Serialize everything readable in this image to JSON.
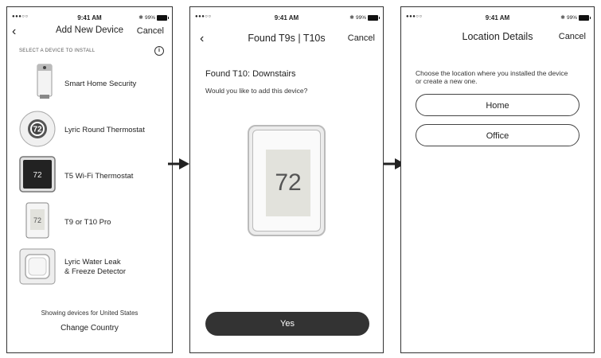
{
  "status": {
    "signal": "●●●○○",
    "time": "9:41 AM",
    "battery": "99%"
  },
  "screen1": {
    "title": "Add New Device",
    "cancel": "Cancel",
    "section": "SELECT A DEVICE TO INSTALL",
    "devices": [
      {
        "label": "Smart Home Security"
      },
      {
        "label": "Lyric Round Thermostat",
        "display": "72"
      },
      {
        "label": "T5 Wi-Fi Thermostat",
        "display": "72"
      },
      {
        "label": "T9 or T10 Pro",
        "display": "72"
      },
      {
        "label": "Lyric Water Leak",
        "label2": "& Freeze Detector"
      }
    ],
    "footer_text": "Showing devices for United States",
    "change_country": "Change Country"
  },
  "screen2": {
    "title": "Found T9s | T10s",
    "cancel": "Cancel",
    "heading": "Found T10: Downstairs",
    "question": "Would you like to add this device?",
    "thermostat_display": "72",
    "yes": "Yes"
  },
  "screen3": {
    "title": "Location Details",
    "cancel": "Cancel",
    "description": "Choose the location where you installed the device or create a new one.",
    "options": [
      "Home",
      "Office"
    ]
  }
}
